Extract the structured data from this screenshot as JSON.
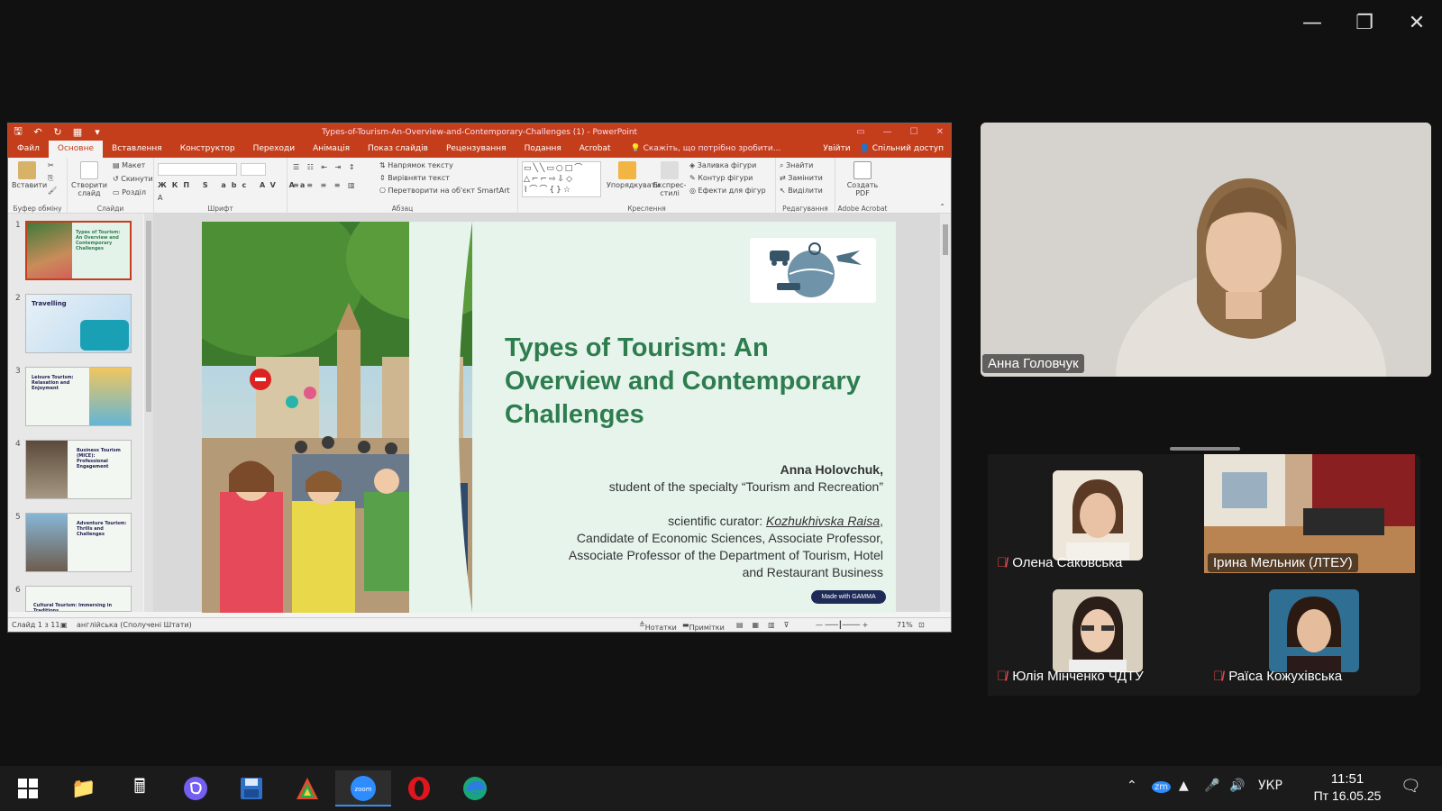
{
  "ppt": {
    "doc_title": "Types-of-Tourism-An-Overview-and-Contemporary-Challenges (1) - PowerPoint",
    "tabs": [
      "Файл",
      "Основне",
      "Вставлення",
      "Конструктор",
      "Переходи",
      "Анімація",
      "Показ слайдів",
      "Рецензування",
      "Подання",
      "Acrobat"
    ],
    "active_tab": "Основне",
    "tell_me": "Скажіть, що потрібно зробити...",
    "sign_in": "Увійти",
    "share": "Спільний доступ",
    "ribbon": {
      "paste": "Вставити",
      "clipboard": "Буфер обміну",
      "new_slide": "Створити слайд",
      "layout": "Макет",
      "reset": "Скинути",
      "section": "Розділ",
      "slides": "Слайди",
      "font": "Шрифт",
      "text_direction": "Напрямок тексту",
      "align_text": "Вирівняти текст",
      "smartart": "Перетворити на об'єкт SmartArt",
      "paragraph": "Абзац",
      "arrange": "Упорядкувати",
      "quick_styles": "Експрес-стилі",
      "shape_fill": "Заливка фігури",
      "shape_outline": "Контур фігури",
      "shape_effects": "Ефекти для фігур",
      "drawing": "Креслення",
      "find": "Знайти",
      "replace": "Замінити",
      "select": "Виділити",
      "editing": "Редагування",
      "create_pdf": "Создать PDF",
      "acrobat": "Adobe Acrobat"
    },
    "thumbnails": [
      {
        "num": "1",
        "text": "Types of Tourism: An Overview and Contemporary Challenges"
      },
      {
        "num": "2",
        "text": "Travelling"
      },
      {
        "num": "3",
        "text": "Leisure Tourism: Relaxation and Enjoyment"
      },
      {
        "num": "4",
        "text": "Business Tourism (MICE): Professional Engagement"
      },
      {
        "num": "5",
        "text": "Adventure Tourism: Thrills and Challenges"
      },
      {
        "num": "6",
        "text": "Cultural Tourism: Immersing in Traditions"
      }
    ],
    "slide": {
      "title": "Types of Tourism: An Overview and Contemporary Challenges",
      "author_name": "Anna Holovchuk,",
      "author_line": "student of the specialty “Tourism and Recreation”",
      "curator_prefix": "scientific curator:",
      "curator_name": "Kozhukhivska Raisa",
      "curator_line1": "Candidate of Economic Sciences, Associate Professor,",
      "curator_line2": "Associate Professor of the Department of Tourism, Hotel",
      "curator_line3": "and Restaurant Business",
      "badge": "Made with GAMMA"
    },
    "status": {
      "slide_count": "Слайд 1 з 11",
      "language": "англійська (Сполучені Штати)",
      "notes": "Нотатки",
      "comments": "Примітки",
      "zoom": "71%"
    }
  },
  "zoom": {
    "speaker": "Анна Головчук",
    "participants": [
      {
        "name": "Олена Саковська",
        "muted": true
      },
      {
        "name": "Ірина Мельник  (ЛТЕУ)",
        "muted": false
      },
      {
        "name": "Юлія Мінченко ЧДТУ",
        "muted": true
      },
      {
        "name": "Раїса Кожухівська",
        "muted": true
      }
    ]
  },
  "taskbar": {
    "lang": "УКР",
    "time": "11:51",
    "date": "Пт 16.05.25"
  },
  "colors": {
    "ppt_accent": "#c43e1c",
    "slide_title": "#2e7d4f",
    "taskbar": "#1b1b1b"
  }
}
